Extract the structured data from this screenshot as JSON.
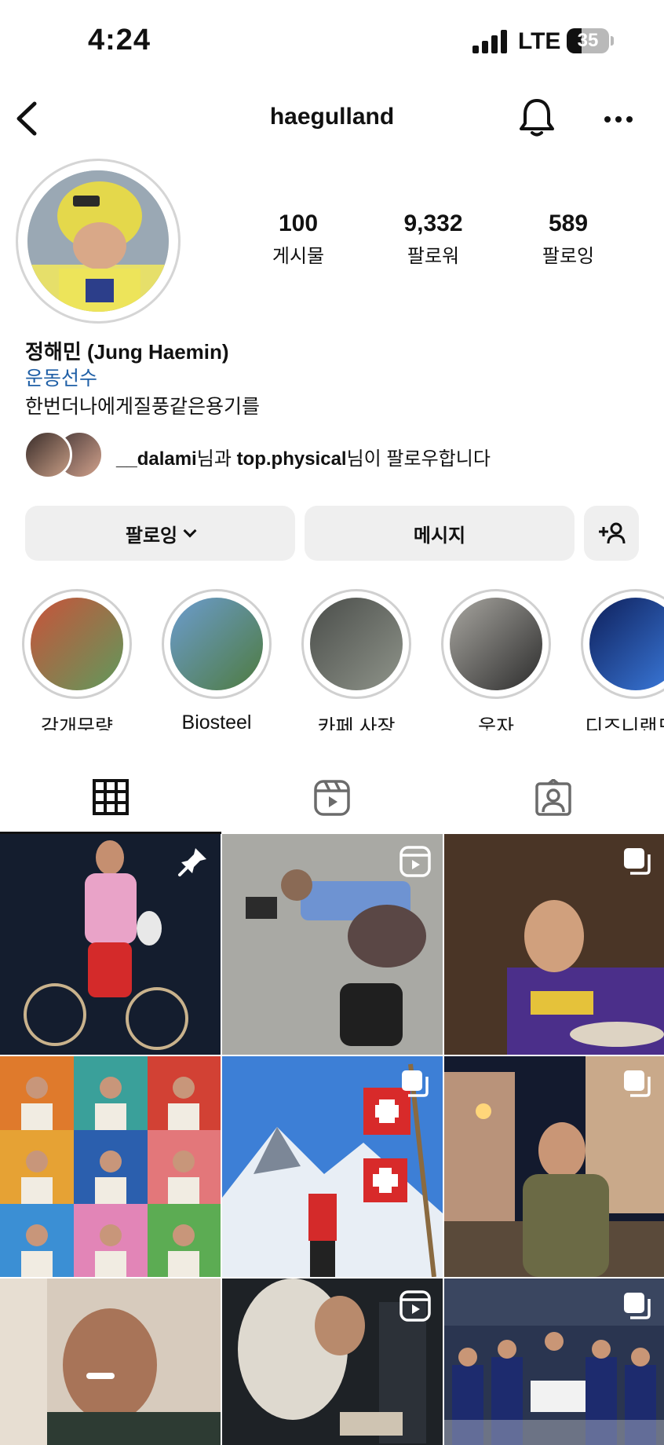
{
  "status_bar": {
    "time": "4:24",
    "network": "LTE",
    "battery": "35",
    "battery_level": 0.35
  },
  "header": {
    "username": "haegulland"
  },
  "profile": {
    "stats": [
      {
        "value": "100",
        "label": "게시물"
      },
      {
        "value": "9,332",
        "label": "팔로워"
      },
      {
        "value": "589",
        "label": "팔로잉"
      }
    ],
    "name": "정해민 (Jung Haemin)",
    "category": "운동선수",
    "bio": "한번더나에게질풍같은용기를",
    "mutual": {
      "user1": "__dalami",
      "conj": "님과 ",
      "user2": "top.physical",
      "suffix": "님이 팔로우합니다"
    }
  },
  "actions": {
    "following": "팔로잉",
    "message": "메시지"
  },
  "highlights": [
    {
      "label": "감개무량",
      "color_a": "#c9523a",
      "color_b": "#5f9a5c"
    },
    {
      "label": "Biosteel",
      "color_a": "#6c9ccf",
      "color_b": "#4e7b3f"
    },
    {
      "label": "카페 사장",
      "color_a": "#4a4d4a",
      "color_b": "#8f948a"
    },
    {
      "label": "웃자",
      "color_a": "#a8a6a0",
      "color_b": "#2c2c2c"
    },
    {
      "label": "디즈니랜드 :",
      "color_a": "#0e1f5a",
      "color_b": "#3c7de0"
    }
  ],
  "tabs": [
    "grid",
    "reels",
    "tagged"
  ],
  "colors": {
    "link": "#1f5fa6",
    "button_bg": "#efefef",
    "text": "#111111"
  }
}
